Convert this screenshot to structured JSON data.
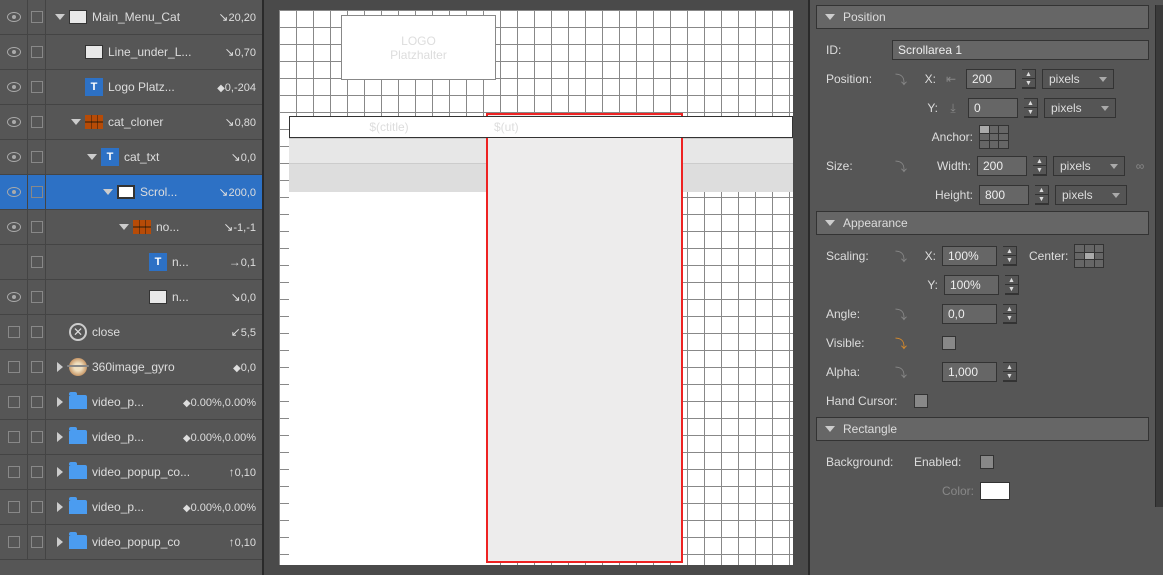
{
  "layers": [
    {
      "vis": "eye",
      "exp": "down",
      "indent": 0,
      "icon": "rect",
      "name": "Main_Menu_Cat",
      "dir": "se",
      "coords": "20,20"
    },
    {
      "vis": "eye",
      "exp": "none",
      "indent": 1,
      "icon": "rect",
      "name": "Line_under_L...",
      "dir": "se",
      "coords": "0,70"
    },
    {
      "vis": "eye",
      "exp": "none",
      "indent": 1,
      "icon": "text",
      "name": "Logo Platz...",
      "dir": "dia",
      "coords": "0,-204"
    },
    {
      "vis": "eye",
      "exp": "down",
      "indent": 1,
      "icon": "grid",
      "name": "cat_cloner",
      "dir": "se",
      "coords": "0,80"
    },
    {
      "vis": "eye",
      "exp": "down",
      "indent": 2,
      "icon": "text",
      "name": "cat_txt",
      "dir": "se",
      "coords": "0,0"
    },
    {
      "vis": "eye",
      "exp": "down",
      "indent": 3,
      "icon": "screen",
      "name": "Scrol...",
      "dir": "se",
      "coords": "200,0",
      "sel": true
    },
    {
      "vis": "eye",
      "exp": "down",
      "indent": 4,
      "icon": "grid",
      "name": "no...",
      "dir": "se",
      "coords": "-1,-1"
    },
    {
      "vis": "none",
      "exp": "none",
      "indent": 5,
      "icon": "text",
      "name": "n...",
      "dir": "r",
      "coords": "0,1"
    },
    {
      "vis": "eye",
      "exp": "none",
      "indent": 5,
      "icon": "rect",
      "name": "n...",
      "dir": "se",
      "coords": "0,0"
    },
    {
      "vis": "box",
      "exp": "none",
      "indent": 0,
      "icon": "close",
      "name": "close",
      "dir": "sw",
      "coords": "5,5"
    },
    {
      "vis": "box",
      "exp": "right",
      "indent": 0,
      "icon": "pano",
      "name": "360image_gyro",
      "dir": "dia",
      "coords": "0,0"
    },
    {
      "vis": "box",
      "exp": "right",
      "indent": 0,
      "icon": "folder",
      "name": "video_p...",
      "dir": "dia",
      "coords": "0.00%,0.00%"
    },
    {
      "vis": "box",
      "exp": "right",
      "indent": 0,
      "icon": "folder",
      "name": "video_p...",
      "dir": "dia",
      "coords": "0.00%,0.00%"
    },
    {
      "vis": "box",
      "exp": "right",
      "indent": 0,
      "icon": "folder",
      "name": "video_popup_co...",
      "dir": "up",
      "coords": "0,10"
    },
    {
      "vis": "box",
      "exp": "right",
      "indent": 0,
      "icon": "folder",
      "name": "video_p...",
      "dir": "dia",
      "coords": "0.00%,0.00%"
    },
    {
      "vis": "box",
      "exp": "right",
      "indent": 0,
      "icon": "folder",
      "name": "video_popup_co",
      "dir": "up",
      "coords": "0,10"
    }
  ],
  "canvas": {
    "logo_line1": "LOGO",
    "logo_line2": "Platzhalter",
    "ctitle": "$(ctitle)",
    "ut": "$(ut)"
  },
  "inspector": {
    "sections": {
      "position": "Position",
      "appearance": "Appearance",
      "rectangle": "Rectangle"
    },
    "labels": {
      "id": "ID:",
      "position": "Position:",
      "x": "X:",
      "y": "Y:",
      "anchor": "Anchor:",
      "size": "Size:",
      "width": "Width:",
      "height": "Height:",
      "scaling": "Scaling:",
      "center": "Center:",
      "angle": "Angle:",
      "visible": "Visible:",
      "alpha": "Alpha:",
      "hand": "Hand Cursor:",
      "background": "Background:",
      "enabled": "Enabled:",
      "color": "Color:"
    },
    "values": {
      "id": "Scrollarea 1",
      "pos_x": "200",
      "pos_y": "0",
      "unit": "pixels",
      "width": "200",
      "height": "800",
      "scale_x": "100%",
      "scale_y": "100%",
      "angle": "0,0",
      "alpha": "1,000"
    }
  }
}
